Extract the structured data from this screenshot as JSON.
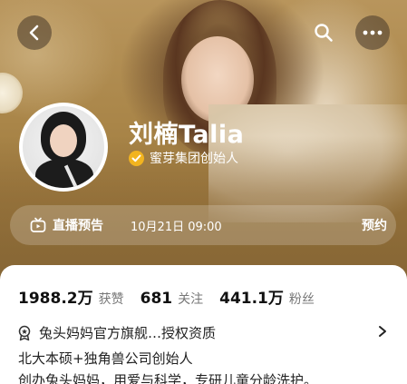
{
  "header": {
    "back_icon": "chevron-left-icon",
    "search_icon": "search-icon",
    "more_icon": "more-dots-icon"
  },
  "profile": {
    "name": "刘楠Talia",
    "certification": "蜜芽集团创始人",
    "cert_badge_color": "#f2b41f"
  },
  "live_preview": {
    "icon": "tv-icon",
    "title": "直播预告",
    "time": "10月21日 09:00",
    "action": "预约"
  },
  "stats": [
    {
      "value": "1988.2万",
      "label": "获赞"
    },
    {
      "value": "681",
      "label": "关注"
    },
    {
      "value": "441.1万",
      "label": "粉丝"
    }
  ],
  "brand": {
    "icon": "award-icon",
    "text": "兔头妈妈官方旗舰…授权资质"
  },
  "bio": {
    "line1": "北大本硕+独角兽公司创始人",
    "line2": "创办兔头妈妈，用爱与科学，专研儿童分龄洗护。"
  },
  "colors": {
    "hero_gold": "#a98548",
    "text_dark": "#111111",
    "text_muted": "#777777"
  }
}
